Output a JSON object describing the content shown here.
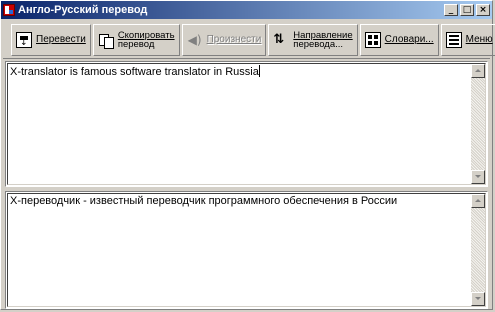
{
  "window": {
    "title": "Англо-Русский перевод",
    "controls": {
      "minimize": "_",
      "maximize": "□",
      "close": "×"
    }
  },
  "toolbar": {
    "translate_label": "Перевести",
    "copy_line1": "Скопировать",
    "copy_line2": "перевод",
    "speak_label": "Произнести",
    "direction_line1": "Направление",
    "direction_line2": "перевода...",
    "dictionaries_label": "Словари...",
    "menu_label": "Меню"
  },
  "source": {
    "text": "X-translator is famous software translator in Russia"
  },
  "target": {
    "text": "X-переводчик - известный переводчик программного обеспечения в России"
  },
  "icons": {
    "app": "app-icon",
    "translate": "translate-icon",
    "copy": "copy-icon",
    "speak": "speaker-icon",
    "direction": "direction-icon",
    "dictionaries": "dictionary-icon",
    "menu": "menu-icon"
  },
  "colors": {
    "titlebar_start": "#0a246a",
    "titlebar_end": "#a6caf0",
    "face": "#d4d0c8"
  }
}
